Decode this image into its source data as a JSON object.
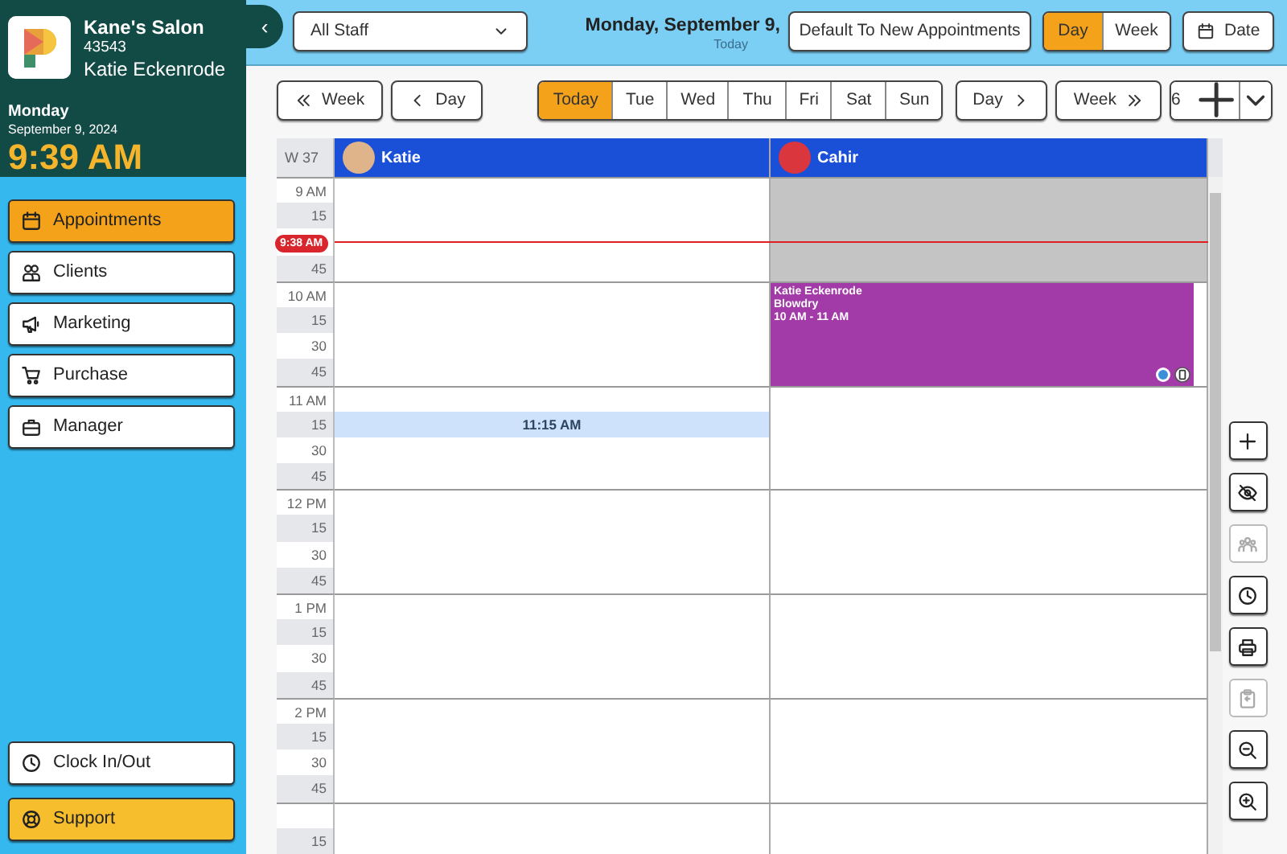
{
  "sidebar": {
    "salon_name": "Kane's Salon",
    "salon_id": "43543",
    "user": "Katie Eckenrode",
    "day": "Monday",
    "date": "September 9, 2024",
    "time": "9:39 AM",
    "nav": [
      {
        "label": "Appointments",
        "selected": true
      },
      {
        "label": "Clients",
        "selected": false
      },
      {
        "label": "Marketing",
        "selected": false
      },
      {
        "label": "Purchase",
        "selected": false
      },
      {
        "label": "Manager",
        "selected": false
      }
    ],
    "bottom": [
      {
        "label": "Clock In/Out",
        "kind": "plain"
      },
      {
        "label": "Support",
        "kind": "highlight"
      }
    ]
  },
  "toolbar": {
    "collapse": "‹",
    "staff_select": "All Staff",
    "date_title": "Monday, September 9,",
    "date_sub": "Today",
    "default_button": "Default To New Appointments",
    "view_toggle": [
      {
        "label": "Day",
        "selected": true
      },
      {
        "label": "Week",
        "selected": false
      }
    ],
    "date_button": "Date"
  },
  "nav_bar": {
    "back": [
      "Week",
      "Day"
    ],
    "days": [
      {
        "label": "Today",
        "selected": true
      },
      {
        "label": "Tue",
        "selected": false
      },
      {
        "label": "Wed",
        "selected": false
      },
      {
        "label": "Thu",
        "selected": false
      },
      {
        "label": "Fri",
        "selected": false
      },
      {
        "label": "Sat",
        "selected": false
      },
      {
        "label": "Sun",
        "selected": false
      }
    ],
    "forward": [
      "Day",
      "Week"
    ],
    "count": "6"
  },
  "calendar": {
    "week": "W 37",
    "staff": [
      {
        "name": "Katie",
        "color": "#e0b48a"
      },
      {
        "name": "Cahir",
        "color": "#d9363e"
      }
    ],
    "appointments": [
      {
        "client": "Katie Eckenrode",
        "service": "Blowdry",
        "time": "10 AM - 11 AM",
        "color": "#a23aa8"
      }
    ],
    "rows": [
      {
        "label": "9 AM",
        "kind": "hour",
        "slots": [
          {
            "kind": "free"
          },
          {
            "kind": "blocked"
          }
        ]
      },
      {
        "label": "15",
        "kind": "quarter",
        "slots": [
          {
            "kind": "free"
          },
          {
            "kind": "blocked"
          }
        ]
      },
      {
        "label": "9:38 AM",
        "kind": "now",
        "slots": [
          {
            "kind": "free"
          },
          {
            "kind": "blocked"
          }
        ]
      },
      {
        "label": "45",
        "kind": "quarter",
        "slots": [
          {
            "kind": "free"
          },
          {
            "kind": "blocked"
          }
        ]
      },
      {
        "label": "10 AM",
        "kind": "hour",
        "slots": [
          {
            "kind": "free"
          },
          {
            "kind": "appointment"
          }
        ]
      },
      {
        "label": "15",
        "kind": "quarter",
        "slots": [
          {
            "kind": "free"
          },
          {
            "kind": "appointment"
          }
        ]
      },
      {
        "label": "30",
        "kind": "quarter",
        "slots": [
          {
            "kind": "free"
          },
          {
            "kind": "appointment"
          }
        ]
      },
      {
        "label": "45",
        "kind": "quarter",
        "slots": [
          {
            "kind": "free"
          },
          {
            "kind": "appointment"
          }
        ]
      },
      {
        "label": "11 AM",
        "kind": "hour",
        "slots": [
          {
            "kind": "free"
          },
          {
            "kind": "free"
          }
        ]
      },
      {
        "label": "15",
        "kind": "quarter",
        "slots": [
          {
            "kind": "hover",
            "label": "11:15 AM"
          },
          {
            "kind": "free"
          }
        ]
      },
      {
        "label": "30",
        "kind": "quarter",
        "slots": [
          {
            "kind": "free"
          },
          {
            "kind": "free"
          }
        ]
      },
      {
        "label": "45",
        "kind": "quarter",
        "slots": [
          {
            "kind": "free"
          },
          {
            "kind": "free"
          }
        ]
      },
      {
        "label": "12 PM",
        "kind": "hour",
        "slots": [
          {
            "kind": "free"
          },
          {
            "kind": "free"
          }
        ]
      },
      {
        "label": "15",
        "kind": "quarter",
        "slots": [
          {
            "kind": "free"
          },
          {
            "kind": "free"
          }
        ]
      },
      {
        "label": "30",
        "kind": "quarter",
        "slots": [
          {
            "kind": "free"
          },
          {
            "kind": "free"
          }
        ]
      },
      {
        "label": "45",
        "kind": "quarter",
        "slots": [
          {
            "kind": "free"
          },
          {
            "kind": "free"
          }
        ]
      },
      {
        "label": "1 PM",
        "kind": "hour",
        "slots": [
          {
            "kind": "free"
          },
          {
            "kind": "free"
          }
        ]
      },
      {
        "label": "15",
        "kind": "quarter",
        "slots": [
          {
            "kind": "free"
          },
          {
            "kind": "free"
          }
        ]
      },
      {
        "label": "30",
        "kind": "quarter",
        "slots": [
          {
            "kind": "free"
          },
          {
            "kind": "free"
          }
        ]
      },
      {
        "label": "45",
        "kind": "quarter",
        "slots": [
          {
            "kind": "free"
          },
          {
            "kind": "free"
          }
        ]
      },
      {
        "label": "2 PM",
        "kind": "hour",
        "slots": [
          {
            "kind": "free"
          },
          {
            "kind": "free"
          }
        ]
      },
      {
        "label": "15",
        "kind": "quarter",
        "slots": [
          {
            "kind": "free"
          },
          {
            "kind": "free"
          }
        ]
      },
      {
        "label": "30",
        "kind": "quarter",
        "slots": [
          {
            "kind": "free"
          },
          {
            "kind": "free"
          }
        ]
      },
      {
        "label": "45",
        "kind": "quarter",
        "slots": [
          {
            "kind": "free"
          },
          {
            "kind": "free"
          }
        ]
      },
      {
        "kind": "hour",
        "slots": [
          {
            "kind": "free"
          },
          {
            "kind": "free"
          }
        ]
      },
      {
        "label": "15",
        "kind": "quarter",
        "slots": [
          {
            "kind": "free"
          },
          {
            "kind": "free"
          }
        ]
      }
    ]
  },
  "tools": [
    {
      "disabled": false
    },
    {
      "disabled": false
    },
    {
      "disabled": true
    },
    {
      "disabled": false
    },
    {
      "disabled": false
    },
    {
      "disabled": true
    },
    {
      "disabled": false
    },
    {
      "disabled": false
    }
  ]
}
